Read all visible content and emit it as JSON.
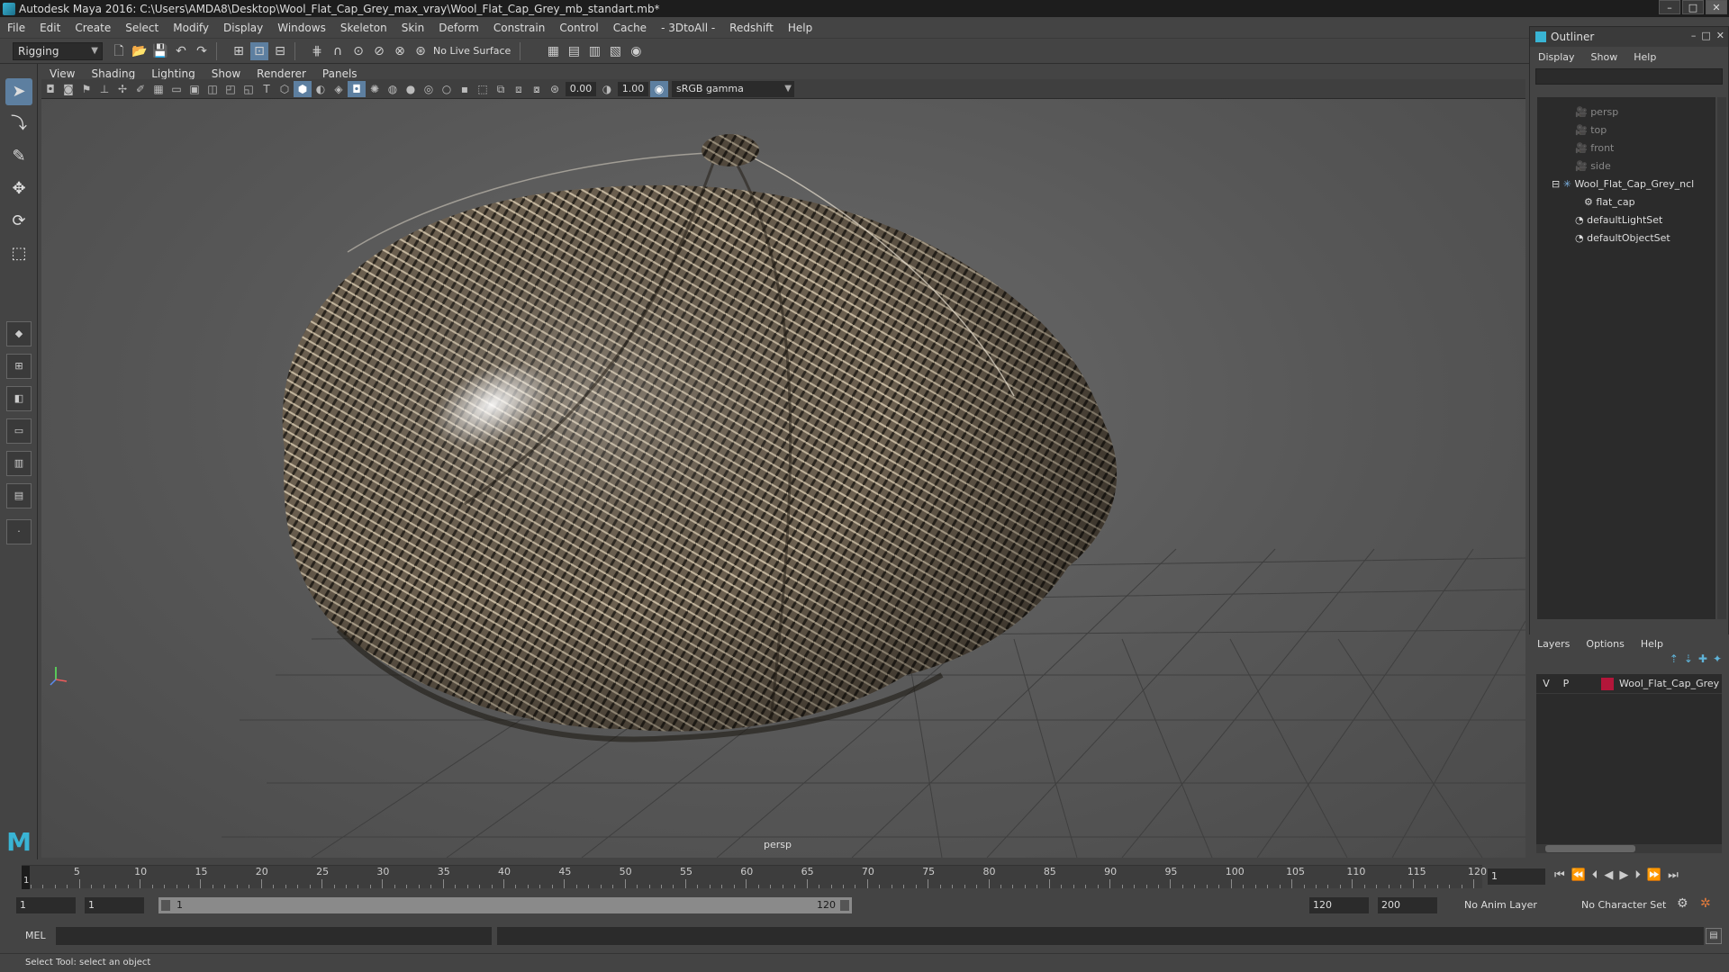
{
  "window": {
    "title": "Autodesk Maya 2016: C:\\Users\\AMDA8\\Desktop\\Wool_Flat_Cap_Grey_max_vray\\Wool_Flat_Cap_Grey_mb_standart.mb*"
  },
  "menubar": [
    "File",
    "Edit",
    "Create",
    "Select",
    "Modify",
    "Display",
    "Windows",
    "Skeleton",
    "Skin",
    "Deform",
    "Constrain",
    "Control",
    "Cache",
    "- 3DtoAll -",
    "Redshift",
    "Help"
  ],
  "statusline": {
    "mode": "Rigging",
    "live_surface": "No Live Surface"
  },
  "panel_menu": [
    "View",
    "Shading",
    "Lighting",
    "Show",
    "Renderer",
    "Panels"
  ],
  "viewbar": {
    "exposure": "0.00",
    "gamma_value": "1.00",
    "color_space": "sRGB gamma"
  },
  "viewport": {
    "camera": "persp"
  },
  "outliner": {
    "title": "Outliner",
    "menu": [
      "Display",
      "Show",
      "Help"
    ],
    "items": [
      {
        "label": "persp"
      },
      {
        "label": "top"
      },
      {
        "label": "front"
      },
      {
        "label": "side"
      },
      {
        "label": "Wool_Flat_Cap_Grey_ncl"
      },
      {
        "label": "flat_cap"
      },
      {
        "label": "defaultLightSet"
      },
      {
        "label": "defaultObjectSet"
      }
    ]
  },
  "layers": {
    "menu": [
      "Layers",
      "Options",
      "Help"
    ],
    "row": {
      "v": "V",
      "p": "P",
      "name": "Wool_Flat_Cap_Grey",
      "color": "#b3163a"
    }
  },
  "timeslider": {
    "labels": [
      "5",
      "10",
      "15",
      "20",
      "25",
      "30",
      "35",
      "40",
      "45",
      "50",
      "55",
      "60",
      "65",
      "70",
      "75",
      "80",
      "85",
      "90",
      "95",
      "100",
      "105",
      "110",
      "115",
      "120"
    ],
    "current_marker": "1",
    "current_frame": "1"
  },
  "rangeslider": {
    "start": "1",
    "playback_start": "1",
    "range_start": "1",
    "range_end": "120",
    "playback_end": "120",
    "end": "200",
    "anim_layer": "No Anim Layer",
    "char_set": "No Character Set"
  },
  "cmdline": {
    "label": "MEL"
  },
  "helpline": {
    "text": "Select Tool: select an object"
  }
}
